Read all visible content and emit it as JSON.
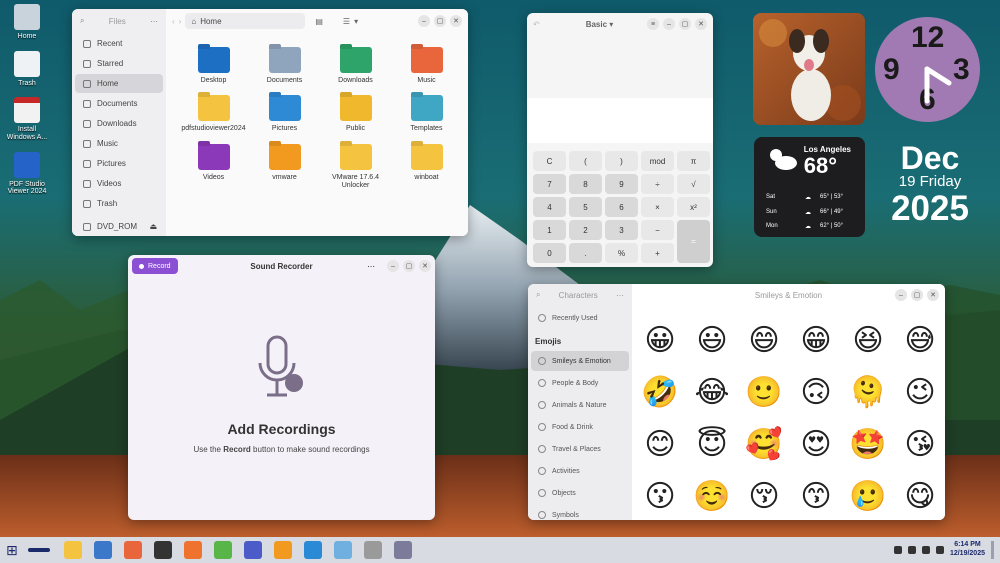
{
  "desktop": {
    "icons": [
      {
        "label": "Home",
        "color": "#c9d3dc"
      },
      {
        "label": "Trash",
        "color": "#eef2f5"
      },
      {
        "label": "Install Windows A...",
        "color": "#f2f2f2"
      },
      {
        "label": "PDF Studio Viewer 2024",
        "color": "#2563c9"
      }
    ]
  },
  "files": {
    "sidebar_title": "Files",
    "sidebar": [
      {
        "label": "Recent",
        "active": false
      },
      {
        "label": "Starred",
        "active": false
      },
      {
        "label": "Home",
        "active": true
      },
      {
        "label": "Documents",
        "active": false
      },
      {
        "label": "Downloads",
        "active": false
      },
      {
        "label": "Music",
        "active": false
      },
      {
        "label": "Pictures",
        "active": false
      },
      {
        "label": "Videos",
        "active": false
      },
      {
        "label": "Trash",
        "active": false
      }
    ],
    "device": "DVD_ROM",
    "path": "Home",
    "items": [
      {
        "label": "Desktop",
        "color": "#1d6fc4"
      },
      {
        "label": "Documents",
        "color": "#8fa5bd"
      },
      {
        "label": "Downloads",
        "color": "#2ea36a"
      },
      {
        "label": "Music",
        "color": "#e9663d"
      },
      {
        "label": "pdfstudioviewer2024",
        "color": "#f4c33f"
      },
      {
        "label": "Pictures",
        "color": "#2f8ad6"
      },
      {
        "label": "Public",
        "color": "#f0b92d"
      },
      {
        "label": "Templates",
        "color": "#3fa6c4"
      },
      {
        "label": "Videos",
        "color": "#8b39b8"
      },
      {
        "label": "vmware",
        "color": "#f29a1f"
      },
      {
        "label": "VMware 17.6.4 Unlocker",
        "color": "#f4c33f"
      },
      {
        "label": "winboat",
        "color": "#f4c33f"
      }
    ]
  },
  "calculator": {
    "mode": "Basic",
    "keys": [
      "C",
      "(",
      ")",
      "mod",
      "π",
      "7",
      "8",
      "9",
      "÷",
      "√",
      "4",
      "5",
      "6",
      "×",
      "x²",
      "1",
      "2",
      "3",
      "−",
      "=",
      "0",
      ".",
      "%",
      "+"
    ]
  },
  "recorder": {
    "record_label": "Record",
    "title": "Sound Recorder",
    "heading": "Add Recordings",
    "hint_pre": "Use the",
    "hint_bold": "Record",
    "hint_post": "button to make sound recordings"
  },
  "characters": {
    "title": "Characters",
    "recent": "Recently Used",
    "section": "Emojis",
    "categories": [
      {
        "label": "Smileys & Emotion",
        "active": true
      },
      {
        "label": "People & Body",
        "active": false
      },
      {
        "label": "Animals & Nature",
        "active": false
      },
      {
        "label": "Food & Drink",
        "active": false
      },
      {
        "label": "Travel & Places",
        "active": false
      },
      {
        "label": "Activities",
        "active": false
      },
      {
        "label": "Objects",
        "active": false
      },
      {
        "label": "Symbols",
        "active": false
      }
    ],
    "main_title": "Smileys & Emotion",
    "emojis": [
      "😀",
      "😃",
      "😄",
      "😁",
      "😆",
      "😅",
      "🤣",
      "😂",
      "🙂",
      "🙃",
      "🫠",
      "😉",
      "😊",
      "😇",
      "🥰",
      "😍",
      "🤩",
      "😘",
      "😗",
      "☺️",
      "😚",
      "😙",
      "🥲",
      "😋"
    ]
  },
  "clock_widget": {
    "hours": [
      "12",
      "9",
      "3",
      "6"
    ]
  },
  "weather": {
    "city": "Los Angeles",
    "temp": "68°",
    "forecast": [
      {
        "day": "Sat",
        "range": "65° | 53°"
      },
      {
        "day": "Sun",
        "range": "66° | 49°"
      },
      {
        "day": "Mon",
        "range": "62° | 50°"
      }
    ]
  },
  "date_widget": {
    "month": "Dec",
    "day": "19 Friday",
    "year": "2025"
  },
  "taskbar": {
    "apps": [
      "#f4c33f",
      "#3b78c9",
      "#e9663d",
      "#333333",
      "#f0722f",
      "#58b548",
      "#4b5cc9",
      "#f29a1f",
      "#2a8ad6",
      "#6fb0e0",
      "#9a9a9a",
      "#7b7b9a"
    ],
    "time": "6:14 PM",
    "date": "12/19/2025"
  }
}
